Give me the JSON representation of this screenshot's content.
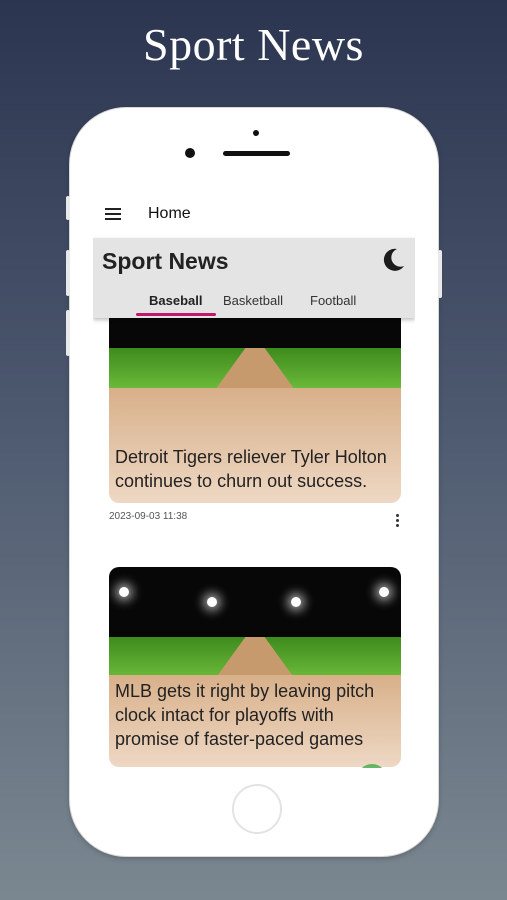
{
  "promo": {
    "title": "Sport News"
  },
  "top_bar": {
    "title": "Home",
    "menu_icon": "hamburger-menu-icon"
  },
  "app": {
    "title": "Sport News",
    "theme_icon": "moon-icon"
  },
  "tabs": [
    {
      "label": "Baseball",
      "active": true
    },
    {
      "label": "Basketball",
      "active": false
    },
    {
      "label": "Football",
      "active": false
    }
  ],
  "colors": {
    "accent": "#c2186b",
    "header_bg": "#e4e4e4"
  },
  "articles": [
    {
      "headline": "Detroit Tigers reliever Tyler Holton continues to churn out success.",
      "date": "2023-09-03 11:38"
    },
    {
      "headline": "MLB gets it right by leaving pitch clock intact for playoffs with promise of faster-paced games"
    }
  ]
}
